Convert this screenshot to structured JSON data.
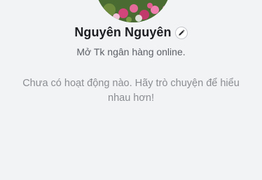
{
  "profile": {
    "name": "Nguyên Nguyên",
    "status": "Mở Tk ngân hàng online.",
    "empty_message": "Chưa có hoạt động nào. Hãy trò chuyện để hiểu nhau hơn!",
    "avatar_description": "avatar-photo",
    "edit_icon": "pencil-icon"
  },
  "colors": {
    "background": "#f2f3f5",
    "name_text": "#1c1e21",
    "status_text": "#5c6066",
    "empty_text": "#8a8d91"
  }
}
